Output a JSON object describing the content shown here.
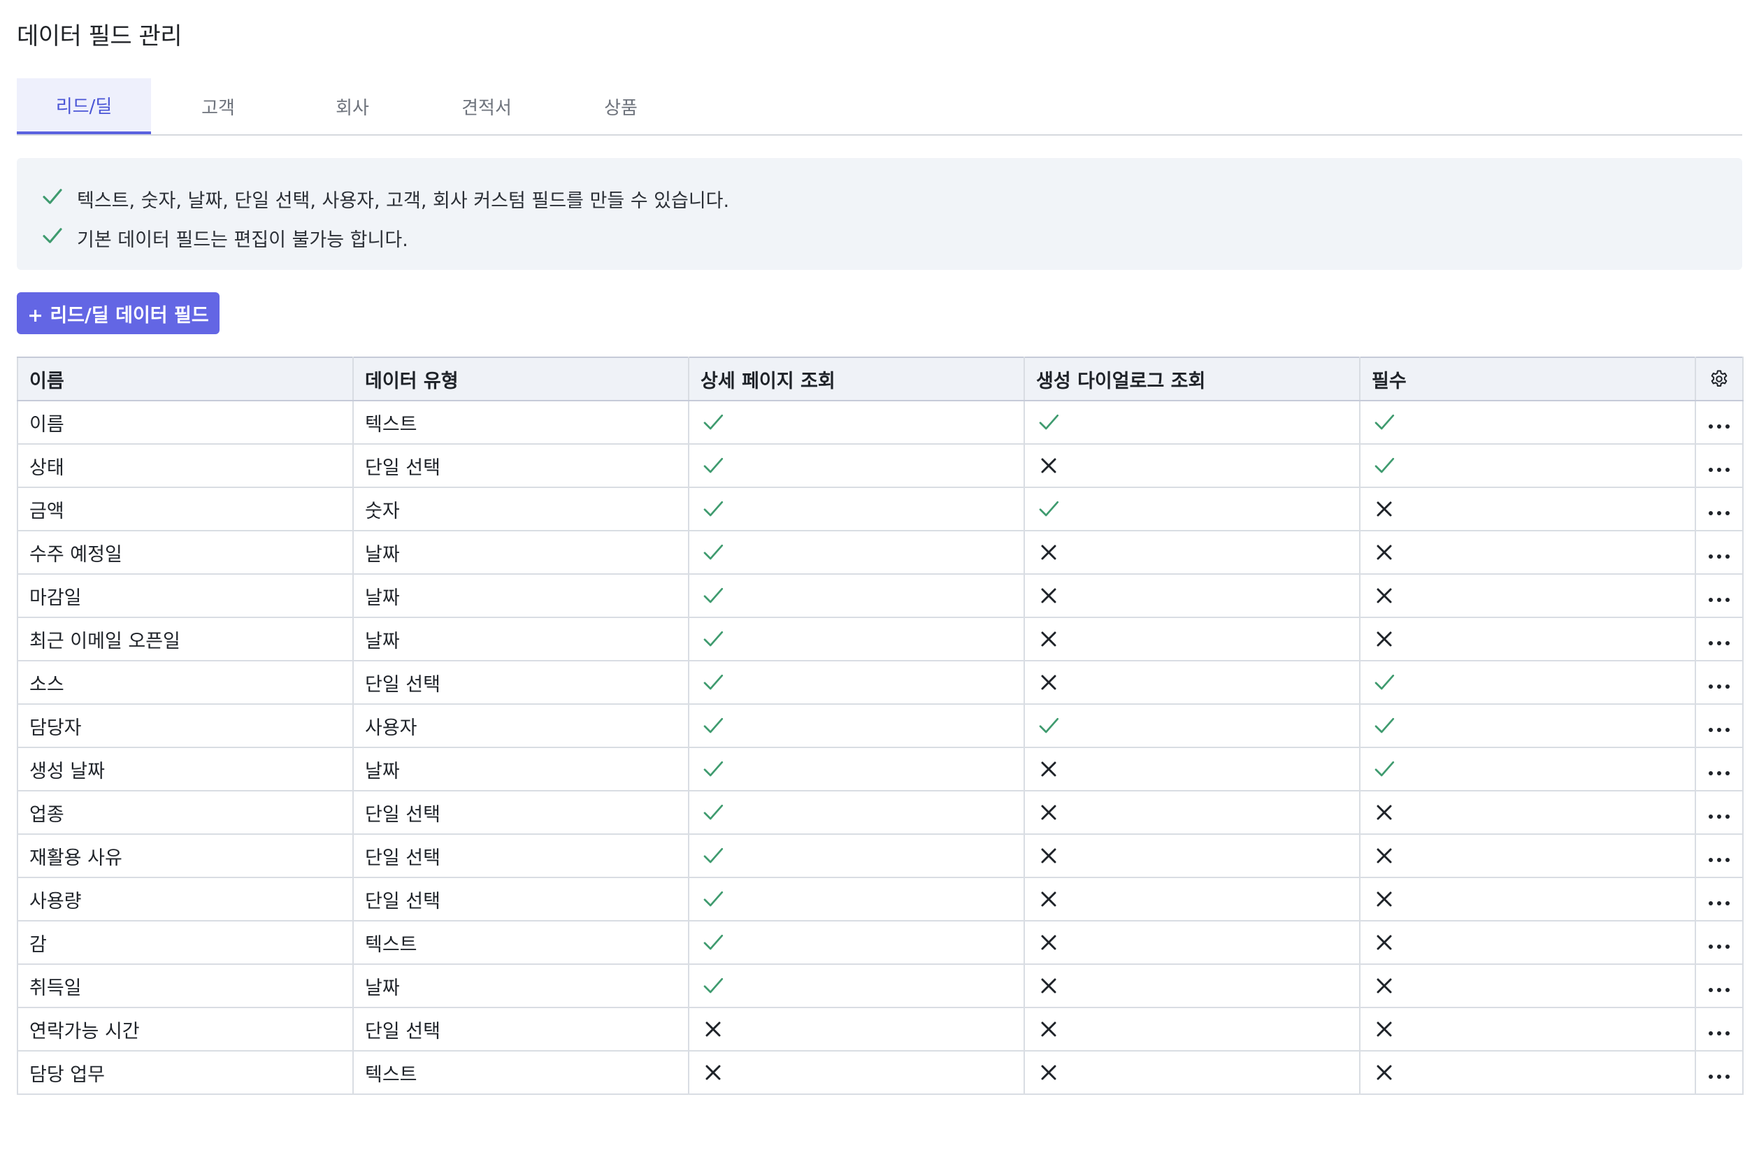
{
  "page": {
    "title": "데이터 필드 관리"
  },
  "tabs": [
    {
      "label": "리드/딜",
      "active": true
    },
    {
      "label": "고객",
      "active": false
    },
    {
      "label": "회사",
      "active": false
    },
    {
      "label": "견적서",
      "active": false
    },
    {
      "label": "상품",
      "active": false
    }
  ],
  "info": {
    "icon": "check-icon",
    "lines": [
      "텍스트, 숫자, 날짜, 단일 선택, 사용자, 고객, 회사 커스텀 필드를 만들 수 있습니다.",
      "기본 데이터 필드는 편집이 불가능 합니다."
    ]
  },
  "add_button": {
    "label": "+ 리드/딜 데이터 필드"
  },
  "table": {
    "columns": [
      "이름",
      "데이터 유형",
      "상세 페이지 조회",
      "생성 다이얼로그 조회",
      "필수"
    ],
    "settings_icon": "gear-icon",
    "row_action_icon": "more-horizontal-icon",
    "rows": [
      {
        "name": "이름",
        "type": "텍스트",
        "detail": true,
        "dialog": true,
        "required": true
      },
      {
        "name": "상태",
        "type": "단일 선택",
        "detail": true,
        "dialog": false,
        "required": true
      },
      {
        "name": "금액",
        "type": "숫자",
        "detail": true,
        "dialog": true,
        "required": false
      },
      {
        "name": "수주 예정일",
        "type": "날짜",
        "detail": true,
        "dialog": false,
        "required": false
      },
      {
        "name": "마감일",
        "type": "날짜",
        "detail": true,
        "dialog": false,
        "required": false
      },
      {
        "name": "최근 이메일 오픈일",
        "type": "날짜",
        "detail": true,
        "dialog": false,
        "required": false
      },
      {
        "name": "소스",
        "type": "단일 선택",
        "detail": true,
        "dialog": false,
        "required": true
      },
      {
        "name": "담당자",
        "type": "사용자",
        "detail": true,
        "dialog": true,
        "required": true
      },
      {
        "name": "생성 날짜",
        "type": "날짜",
        "detail": true,
        "dialog": false,
        "required": true
      },
      {
        "name": "업종",
        "type": "단일 선택",
        "detail": true,
        "dialog": false,
        "required": false
      },
      {
        "name": "재활용 사유",
        "type": "단일 선택",
        "detail": true,
        "dialog": false,
        "required": false
      },
      {
        "name": "사용량",
        "type": "단일 선택",
        "detail": true,
        "dialog": false,
        "required": false
      },
      {
        "name": "감",
        "type": "텍스트",
        "detail": true,
        "dialog": false,
        "required": false
      },
      {
        "name": "취득일",
        "type": "날짜",
        "detail": true,
        "dialog": false,
        "required": false
      },
      {
        "name": "연락가능 시간",
        "type": "단일 선택",
        "detail": false,
        "dialog": false,
        "required": false
      },
      {
        "name": "담당 업무",
        "type": "텍스트",
        "detail": false,
        "dialog": false,
        "required": false
      }
    ]
  },
  "colors": {
    "accent": "#5a62df",
    "button": "#6366e4",
    "check": "#3f9b6f",
    "cross": "#1f2329"
  }
}
